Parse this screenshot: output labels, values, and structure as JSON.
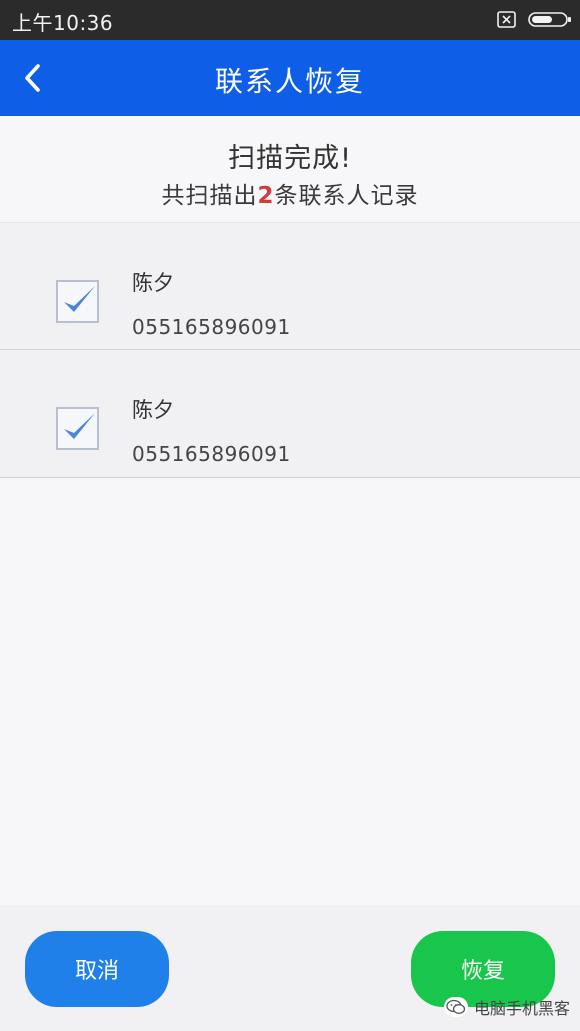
{
  "status_bar": {
    "time": "上午10:36",
    "sim_icon": "sim-off-icon",
    "battery_icon": "battery-icon"
  },
  "app_bar": {
    "back_icon": "chevron-left-icon",
    "title": "联系人恢复"
  },
  "scan_summary": {
    "title": "扫描完成!",
    "count_prefix": "共扫描出",
    "count": "2",
    "count_suffix": "条联系人记录"
  },
  "contacts": [
    {
      "name": "陈夕",
      "phone": "055165896091",
      "checked": true
    },
    {
      "name": "陈夕",
      "phone": "055165896091",
      "checked": true
    }
  ],
  "bottom_bar": {
    "cancel_label": "取消",
    "restore_label": "恢复"
  },
  "watermark": {
    "text": "电脑手机黑客"
  },
  "colors": {
    "status_bar": "#2b2b2b",
    "app_bar": "#0f5ee8",
    "count_highlight": "#d43a3a",
    "checkmark": "#4a86d6",
    "cancel_button": "#1f80ea",
    "restore_button": "#17c64a"
  }
}
